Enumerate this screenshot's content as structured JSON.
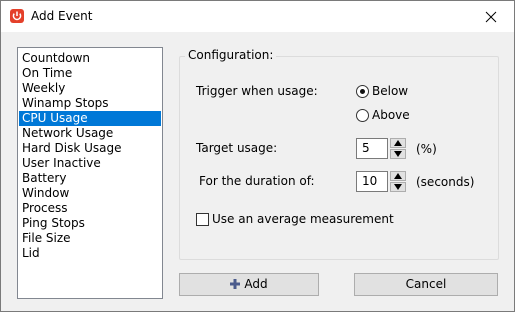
{
  "window": {
    "title": "Add Event",
    "app_icon": "power-icon",
    "close_icon": "close-icon"
  },
  "event_list": {
    "items": [
      {
        "label": "Countdown"
      },
      {
        "label": "On Time"
      },
      {
        "label": "Weekly"
      },
      {
        "label": "Winamp Stops"
      },
      {
        "label": "CPU Usage",
        "selected": true
      },
      {
        "label": "Network Usage"
      },
      {
        "label": "Hard Disk Usage"
      },
      {
        "label": "User Inactive"
      },
      {
        "label": "Battery"
      },
      {
        "label": "Window"
      },
      {
        "label": "Process"
      },
      {
        "label": "Ping Stops"
      },
      {
        "label": "File Size"
      },
      {
        "label": "Lid"
      }
    ]
  },
  "configuration": {
    "title": "Configuration:",
    "trigger_label": "Trigger when usage:",
    "below_label": "Below",
    "below_selected": true,
    "above_label": "Above",
    "above_selected": false,
    "target_label": "Target usage:",
    "target_value": "5",
    "target_unit": "(%)",
    "duration_label": "For the duration of:",
    "duration_value": "10",
    "duration_unit": "(seconds)",
    "average_label": "Use an average measurement",
    "average_checked": false
  },
  "buttons": {
    "add_label": "Add",
    "add_icon": "plus-icon",
    "cancel_label": "Cancel"
  },
  "colors": {
    "selection": "#0078d7",
    "app_icon": "#e4402a",
    "plus_icon": "#4a5a8c"
  }
}
